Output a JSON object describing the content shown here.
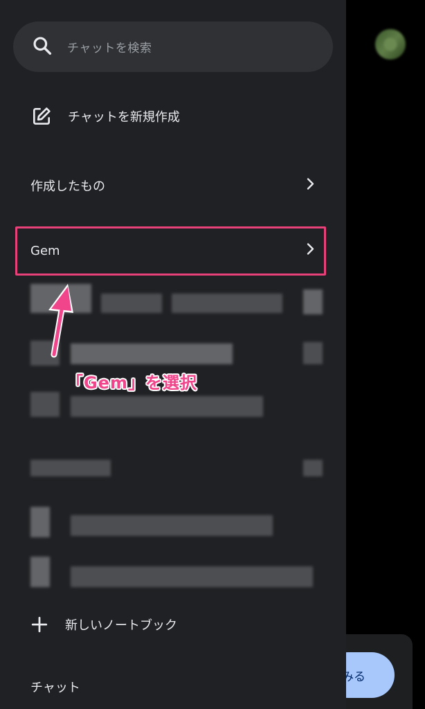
{
  "search": {
    "placeholder": "チャットを検索"
  },
  "menu": {
    "new_chat": "チャットを新規作成",
    "created": "作成したもの",
    "gem": "Gem",
    "new_notebook": "新しいノートブック",
    "chat_section": "チャット"
  },
  "annotation": {
    "text": "「Gem」を選択"
  },
  "bottom": {
    "try_label": "みる"
  },
  "colors": {
    "drawer_bg": "#202124",
    "highlight": "#e8417a",
    "annotation": "#f0458a"
  }
}
